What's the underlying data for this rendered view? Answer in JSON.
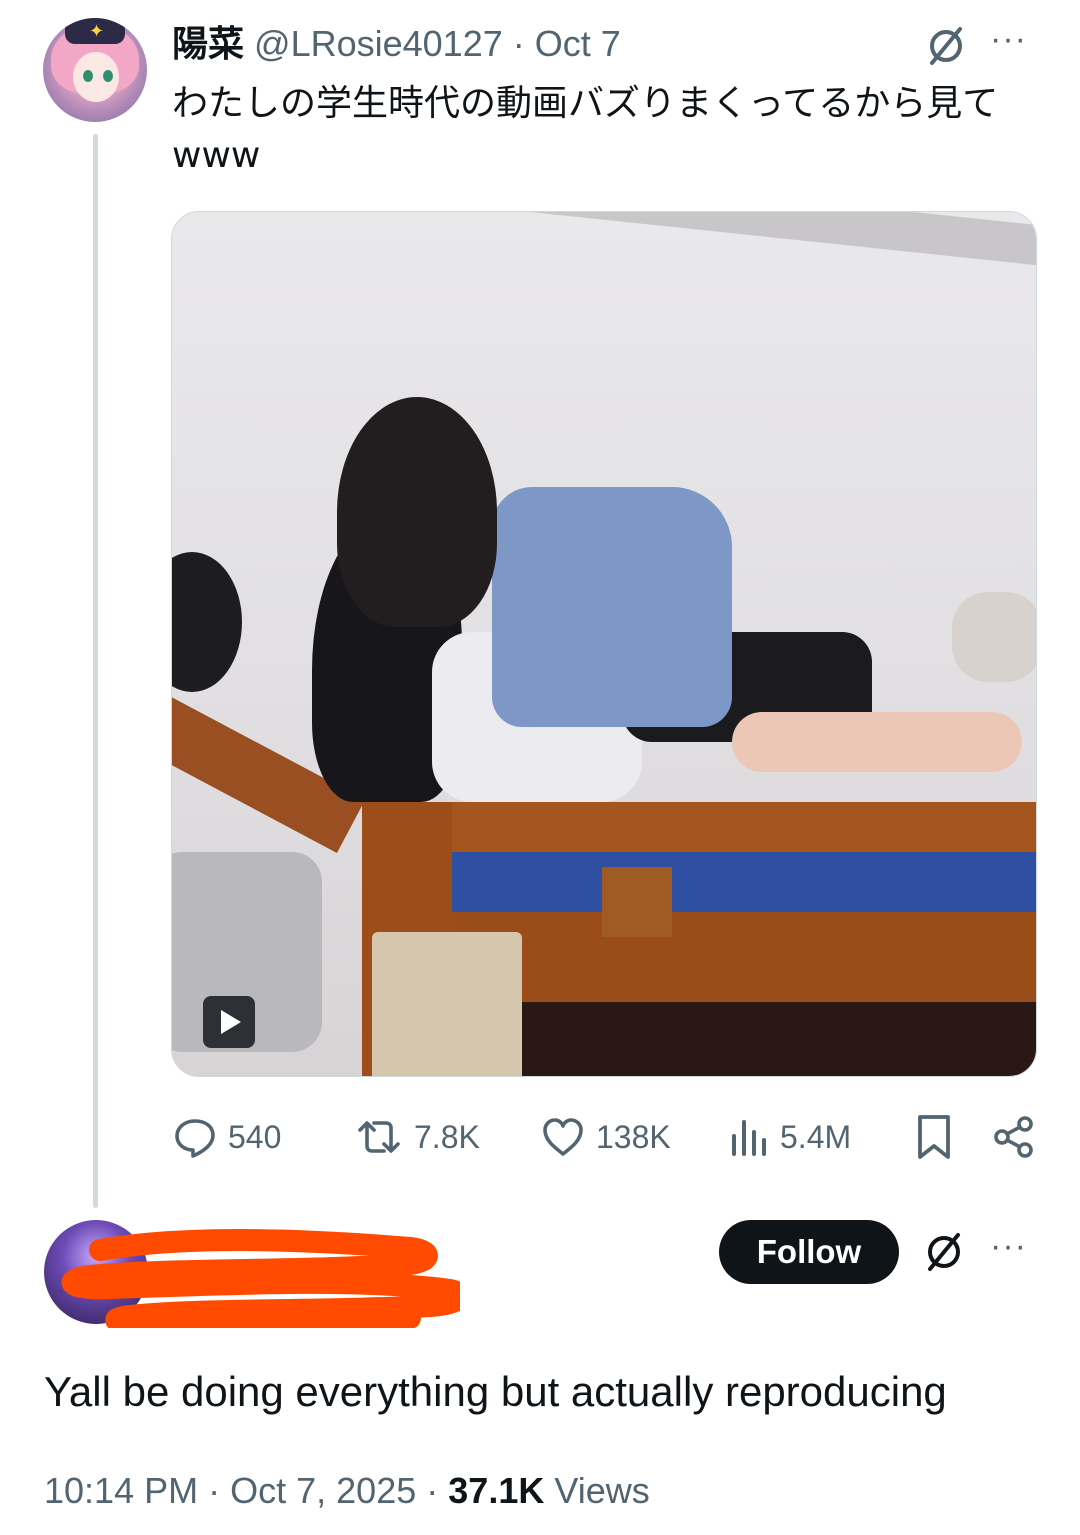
{
  "parent_tweet": {
    "display_name": "陽菜",
    "handle": "@LRosie40127",
    "separator": "·",
    "date": "Oct 7",
    "more_label": "···",
    "text": "わたしの学生時代の動画バズりまくってるから見てwww",
    "media": {
      "type": "video",
      "play_icon": "play-icon"
    },
    "stats": {
      "replies": "540",
      "retweets": "7.8K",
      "likes": "138K",
      "views": "5.4M"
    }
  },
  "reply_tweet": {
    "follow_label": "Follow",
    "more_label": "···",
    "text": "Yall be doing everything but actually reproducing",
    "time": "10:14 PM",
    "separator": "·",
    "date": "Oct 7, 2025",
    "separator2": "·",
    "views_count": "37.1K",
    "views_label": "Views"
  },
  "colors": {
    "text_primary": "#0f1419",
    "text_secondary": "#536471",
    "thread_line": "#cfd9de",
    "follow_bg": "#0f1419",
    "redaction": "#ff4a00"
  }
}
